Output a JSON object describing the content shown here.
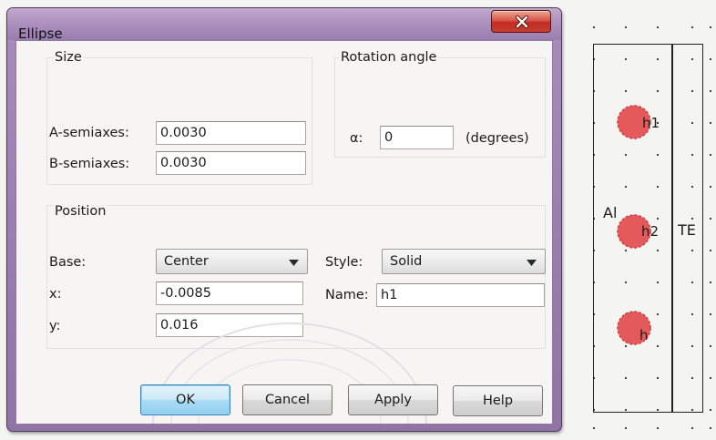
{
  "dialog": {
    "title": "Ellipse",
    "close_icon": "close-x-icon"
  },
  "size": {
    "group_label": "Size",
    "a_label": "A-semiaxes:",
    "a_value": "0.0030",
    "b_label": "B-semiaxes:",
    "b_value": "0.0030"
  },
  "rotation": {
    "group_label": "Rotation angle",
    "alpha_label": "α:",
    "alpha_value": "0",
    "unit": "(degrees)"
  },
  "position": {
    "group_label": "Position",
    "base_label": "Base:",
    "base_value": "Center",
    "x_label": "x:",
    "x_value": "-0.0085",
    "y_label": "y:",
    "y_value": "0.016",
    "style_label": "Style:",
    "style_value": "Solid",
    "name_label": "Name:",
    "name_value": "h1"
  },
  "buttons": {
    "ok": "OK",
    "cancel": "Cancel",
    "apply": "Apply",
    "help": "Help"
  },
  "canvas": {
    "region_left_label": "Al",
    "region_right_label": "TE",
    "holes": [
      "h1",
      "h2",
      "h"
    ],
    "hole_color": "#e45a5a"
  }
}
